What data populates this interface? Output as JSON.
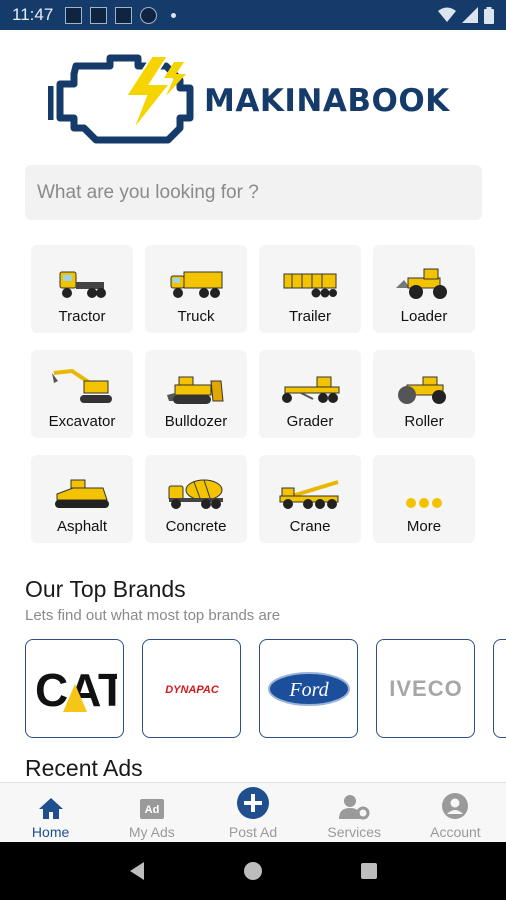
{
  "status_bar": {
    "time": "11:47"
  },
  "brand": {
    "name": "MAKINABOOK"
  },
  "search": {
    "placeholder": "What are you looking for ?"
  },
  "categories": [
    {
      "label": "Tractor",
      "icon": "tractor-truck-icon"
    },
    {
      "label": "Truck",
      "icon": "dump-truck-icon"
    },
    {
      "label": "Trailer",
      "icon": "trailer-icon"
    },
    {
      "label": "Loader",
      "icon": "wheel-loader-icon"
    },
    {
      "label": "Excavator",
      "icon": "excavator-icon"
    },
    {
      "label": "Bulldozer",
      "icon": "bulldozer-icon"
    },
    {
      "label": "Grader",
      "icon": "grader-icon"
    },
    {
      "label": "Roller",
      "icon": "road-roller-icon"
    },
    {
      "label": "Asphalt",
      "icon": "asphalt-paver-icon"
    },
    {
      "label": "Concrete",
      "icon": "concrete-mixer-icon"
    },
    {
      "label": "Crane",
      "icon": "crane-icon"
    },
    {
      "label": "More",
      "icon": "more-dots-icon"
    }
  ],
  "top_brands": {
    "title": "Our Top Brands",
    "subtitle": "Lets find out what most top brands are",
    "items": [
      {
        "name": "CAT"
      },
      {
        "name": "DYNAPAC"
      },
      {
        "name": "Ford"
      },
      {
        "name": "IVECO"
      }
    ]
  },
  "recent": {
    "title": "Recent Ads"
  },
  "bottom_nav": [
    {
      "label": "Home",
      "icon": "home-icon",
      "active": true
    },
    {
      "label": "My Ads",
      "icon": "ad-icon",
      "active": false
    },
    {
      "label": "Post Ad",
      "icon": "add-circle-icon",
      "active": false
    },
    {
      "label": "Services",
      "icon": "user-gear-icon",
      "active": false
    },
    {
      "label": "Account",
      "icon": "account-icon",
      "active": false
    }
  ],
  "colors": {
    "primary": "#153b6b",
    "accent": "#f5c518",
    "nav_active": "#1f4f8f"
  }
}
